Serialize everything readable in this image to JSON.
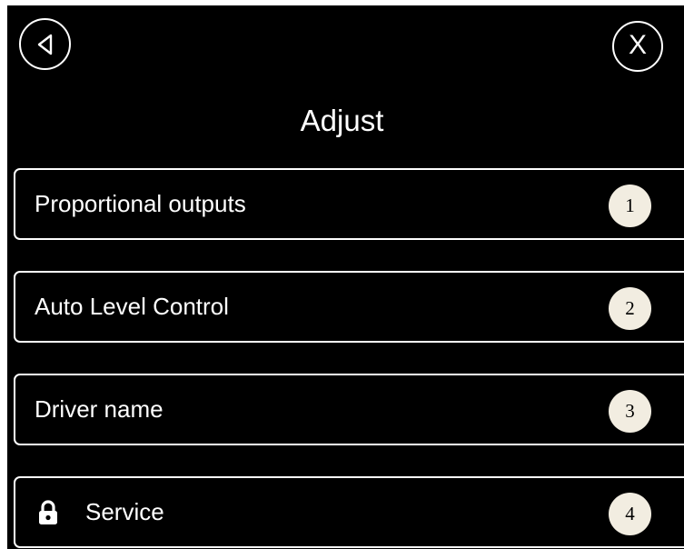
{
  "header": {
    "back_icon": "back-triangle-icon",
    "close_label": "X",
    "title": "Adjust"
  },
  "menu": {
    "items": [
      {
        "label": "Proportional outputs",
        "badge": "1",
        "locked": false
      },
      {
        "label": "Auto Level Control",
        "badge": "2",
        "locked": false
      },
      {
        "label": "Driver name",
        "badge": "3",
        "locked": false
      },
      {
        "label": "Service",
        "badge": "4",
        "locked": true,
        "icon": "lock-icon"
      }
    ]
  },
  "colors": {
    "background": "#000000",
    "foreground": "#ffffff",
    "badge_fill": "#f2ede1"
  }
}
